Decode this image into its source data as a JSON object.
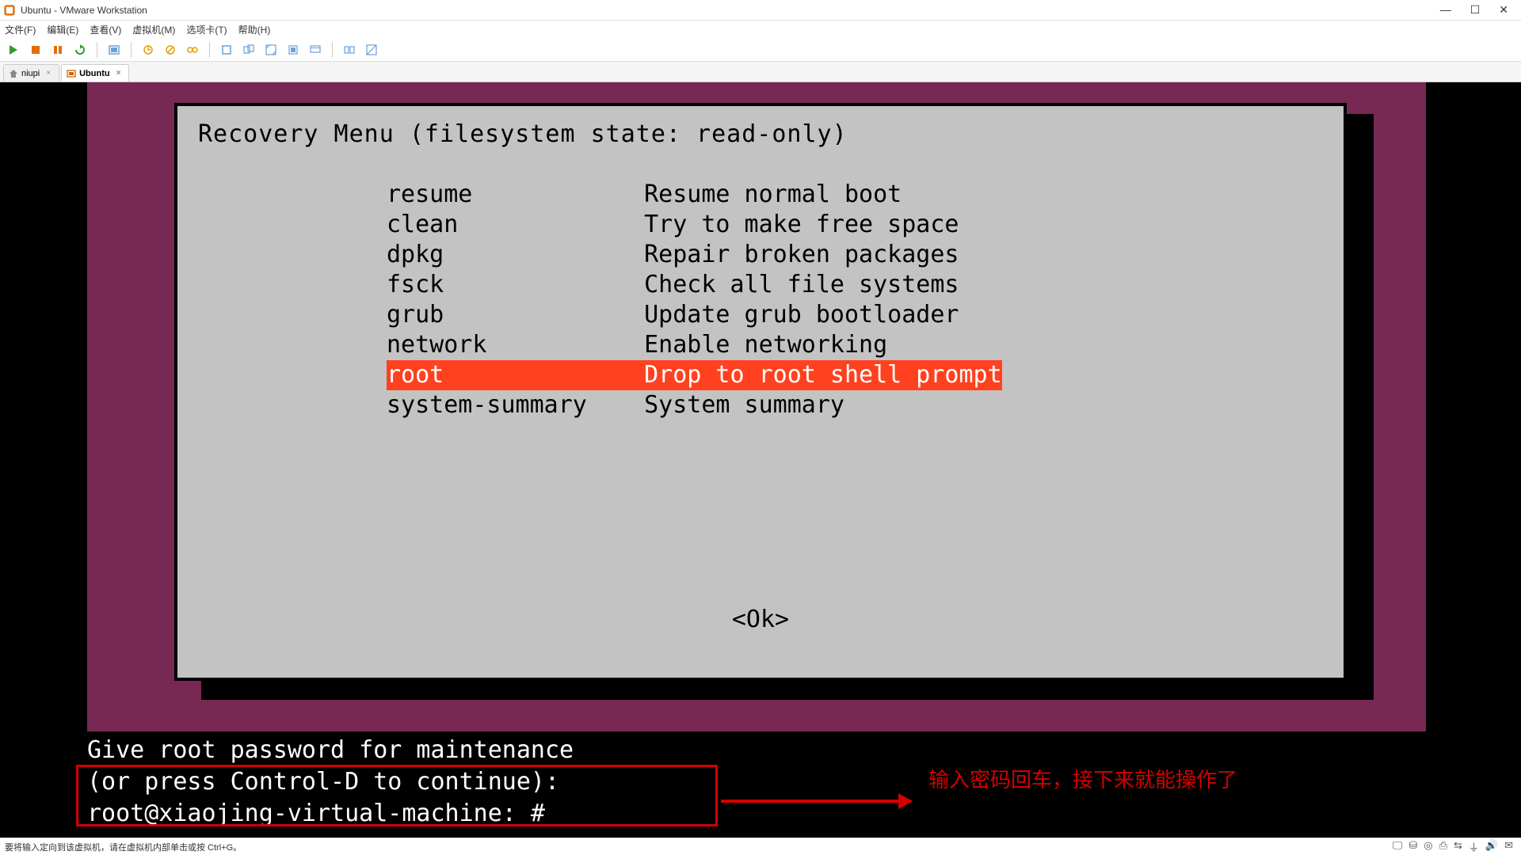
{
  "titlebar": {
    "title": "Ubuntu - VMware Workstation"
  },
  "menubar": {
    "items": [
      "文件(F)",
      "编辑(E)",
      "查看(V)",
      "虚拟机(M)",
      "选项卡(T)",
      "帮助(H)"
    ]
  },
  "tabs": [
    {
      "label": "niupi",
      "active": false
    },
    {
      "label": "Ubuntu",
      "active": true
    }
  ],
  "recovery": {
    "title": "Recovery Menu (filesystem state: read-only)",
    "items": [
      {
        "key": "resume",
        "desc": "Resume normal boot",
        "selected": false
      },
      {
        "key": "clean",
        "desc": "Try to make free space",
        "selected": false
      },
      {
        "key": "dpkg",
        "desc": "Repair broken packages",
        "selected": false
      },
      {
        "key": "fsck",
        "desc": "Check all file systems",
        "selected": false
      },
      {
        "key": "grub",
        "desc": "Update grub bootloader",
        "selected": false
      },
      {
        "key": "network",
        "desc": "Enable networking",
        "selected": false
      },
      {
        "key": "root",
        "desc": "Drop to root shell prompt",
        "selected": true
      },
      {
        "key": "system-summary",
        "desc": "System summary",
        "selected": false
      }
    ],
    "ok": "<Ok>"
  },
  "terminal": {
    "line1": "Give root password for maintenance",
    "line2": "(or press Control-D to continue):",
    "line3": "root@xiaojing-virtual-machine: # _"
  },
  "annotation": {
    "text": "输入密码回车，接下来就能操作了"
  },
  "statusbar": {
    "hint": "要将输入定向到该虚拟机，请在虚拟机内部单击或按 Ctrl+G。"
  }
}
